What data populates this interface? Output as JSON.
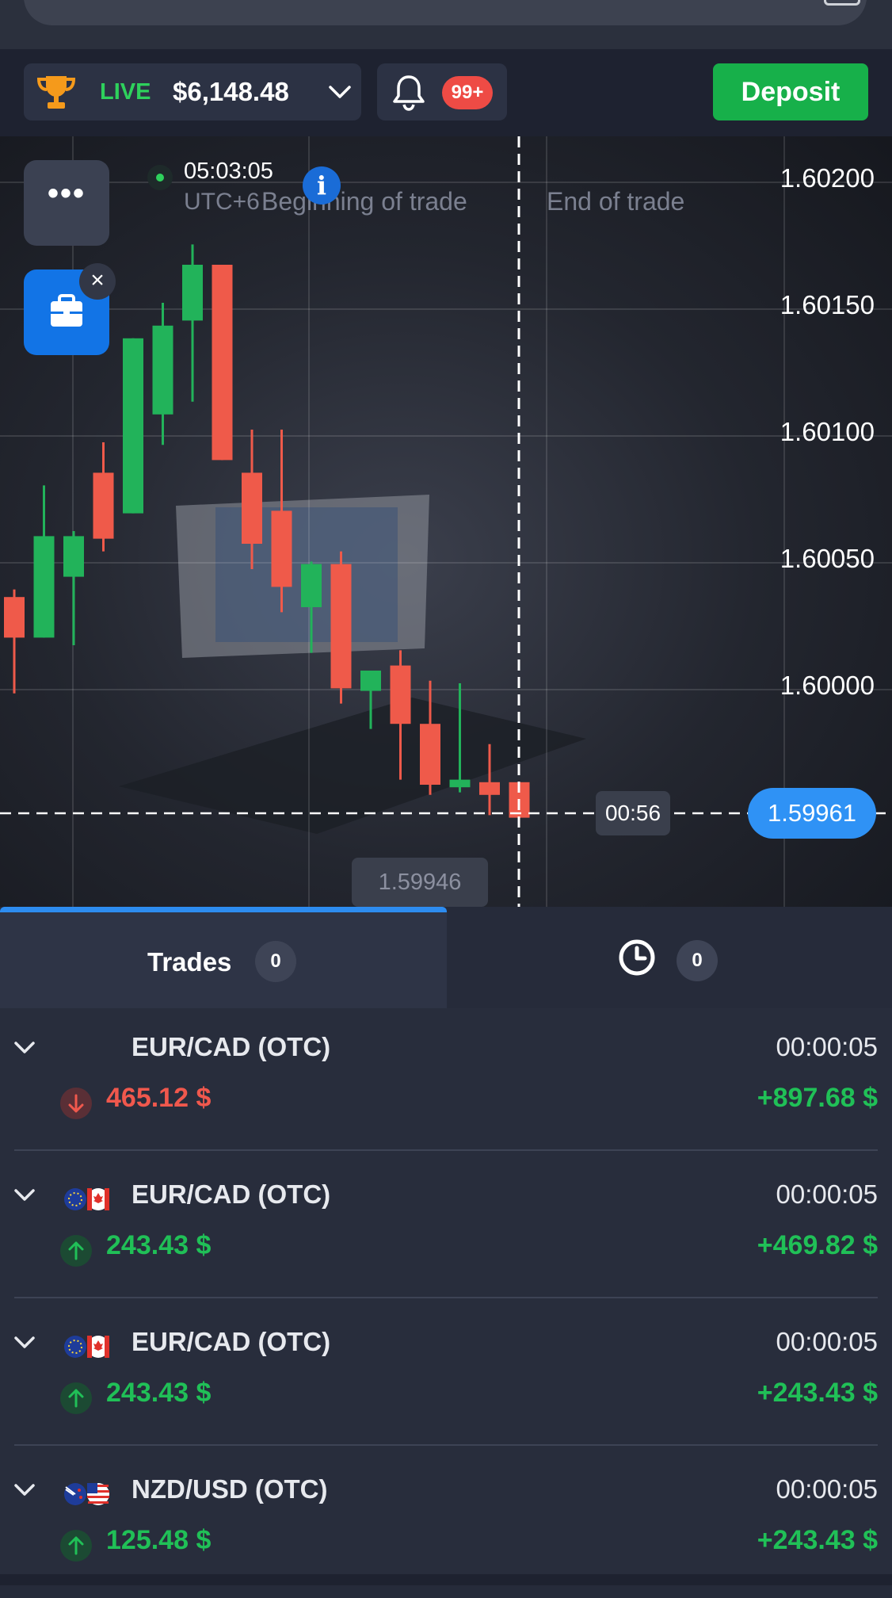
{
  "account": {
    "mode": "LIVE",
    "balance": "$6,148.48"
  },
  "notifications": {
    "badge": "99+"
  },
  "deposit_label": "Deposit",
  "chart": {
    "clock_time": "05:03:05",
    "timezone": "UTC+6",
    "begin_label": "Beginning of trade",
    "end_label": "End of trade",
    "price_levels": [
      "1.60200",
      "1.60150",
      "1.60100",
      "1.60050",
      "1.60000"
    ],
    "countdown": "00:56",
    "current_price": "1.59961",
    "low_price": "1.59946",
    "colors": {
      "up": "#22b35a",
      "down": "#ef5a4a"
    }
  },
  "chart_data": {
    "type": "candlestick",
    "yticks": [
      1.602,
      1.6015,
      1.601,
      1.6005,
      1.6
    ],
    "ylim": [
      1.59946,
      1.60224
    ],
    "current": 1.59961,
    "candles": [
      {
        "o": 1.60034,
        "c": 1.60018,
        "h": 1.60037,
        "l": 1.59996
      },
      {
        "o": 1.60018,
        "c": 1.60058,
        "h": 1.60078,
        "l": 1.60018
      },
      {
        "o": 1.60042,
        "c": 1.60058,
        "h": 1.6006,
        "l": 1.60015
      },
      {
        "o": 1.60083,
        "c": 1.60057,
        "h": 1.60095,
        "l": 1.60052
      },
      {
        "o": 1.60067,
        "c": 1.60136,
        "h": 1.60136,
        "l": 1.60067
      },
      {
        "o": 1.60106,
        "c": 1.60141,
        "h": 1.6015,
        "l": 1.60094
      },
      {
        "o": 1.60143,
        "c": 1.60165,
        "h": 1.60173,
        "l": 1.60111
      },
      {
        "o": 1.60165,
        "c": 1.60088,
        "h": 1.60165,
        "l": 1.60088
      },
      {
        "o": 1.60083,
        "c": 1.60055,
        "h": 1.601,
        "l": 1.60045
      },
      {
        "o": 1.60068,
        "c": 1.60038,
        "h": 1.601,
        "l": 1.60028
      },
      {
        "o": 1.6003,
        "c": 1.60047,
        "h": 1.60048,
        "l": 1.60012
      },
      {
        "o": 1.60047,
        "c": 1.59998,
        "h": 1.60052,
        "l": 1.59992
      },
      {
        "o": 1.59997,
        "c": 1.60005,
        "h": 1.60005,
        "l": 1.59982
      },
      {
        "o": 1.60007,
        "c": 1.59984,
        "h": 1.60013,
        "l": 1.59962
      },
      {
        "o": 1.59984,
        "c": 1.5996,
        "h": 1.60001,
        "l": 1.59956
      },
      {
        "o": 1.59959,
        "c": 1.59962,
        "h": 1.6,
        "l": 1.59957
      },
      {
        "o": 1.59961,
        "c": 1.59956,
        "h": 1.59976,
        "l": 1.59948
      },
      {
        "o": 1.59961,
        "c": 1.59947,
        "h": 1.59961,
        "l": 1.59947
      }
    ]
  },
  "tabs": {
    "trades_label": "Trades",
    "trades_count": "0",
    "history_count": "0"
  },
  "trades": [
    {
      "pair": "EUR/CAD (OTC)",
      "time": "00:00:05",
      "amount": "465.12 $",
      "payout": "+897.68 $",
      "direction": "down",
      "flags": false
    },
    {
      "pair": "EUR/CAD (OTC)",
      "time": "00:00:05",
      "amount": "243.43 $",
      "payout": "+469.82 $",
      "direction": "up",
      "flags": [
        "eu",
        "ca"
      ]
    },
    {
      "pair": "EUR/CAD (OTC)",
      "time": "00:00:05",
      "amount": "243.43 $",
      "payout": "+243.43 $",
      "direction": "up",
      "flags": [
        "eu",
        "ca"
      ]
    },
    {
      "pair": "NZD/USD (OTC)",
      "time": "00:00:05",
      "amount": "125.48 $",
      "payout": "+243.43 $",
      "direction": "up",
      "flags": [
        "nz",
        "us"
      ]
    }
  ]
}
